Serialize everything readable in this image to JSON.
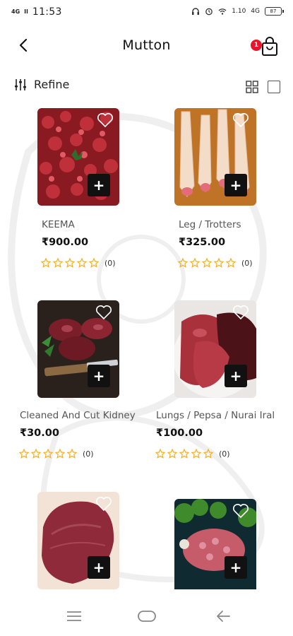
{
  "status_bar": {
    "network_left": "4G",
    "carrier_signal": "Il",
    "time": "11:53",
    "speed": "1.10",
    "network_right": "4G",
    "battery": "87"
  },
  "header": {
    "title": "Mutton",
    "cart_count": "1"
  },
  "toolbar": {
    "refine_label": "Refine"
  },
  "products": [
    {
      "name": "KEEMA",
      "price": "₹900.00",
      "rating_count": "(0)"
    },
    {
      "name": "Leg / Trotters",
      "price": "₹325.00",
      "rating_count": "(0)"
    },
    {
      "name": "Cleaned And Cut Kidney",
      "price": "₹30.00",
      "rating_count": "(0)"
    },
    {
      "name": "Lungs / Pepsa / Nurai Iral",
      "price": "₹100.00",
      "rating_count": "(0)"
    },
    {
      "name": "",
      "price": "",
      "rating_count": ""
    },
    {
      "name": "",
      "price": "",
      "rating_count": ""
    }
  ],
  "colors": {
    "star": "#f2b01e",
    "badge": "#e5162a",
    "add_button": "#111111"
  },
  "icons": {
    "back": "back-arrow-icon",
    "cart": "shopping-bag-icon",
    "refine": "sliders-icon",
    "grid": "grid-view-icon",
    "list": "single-view-icon",
    "favorite": "heart-icon",
    "add": "plus-icon",
    "nav_menu": "menu-icon",
    "nav_home": "home-icon",
    "nav_back": "back-icon"
  }
}
